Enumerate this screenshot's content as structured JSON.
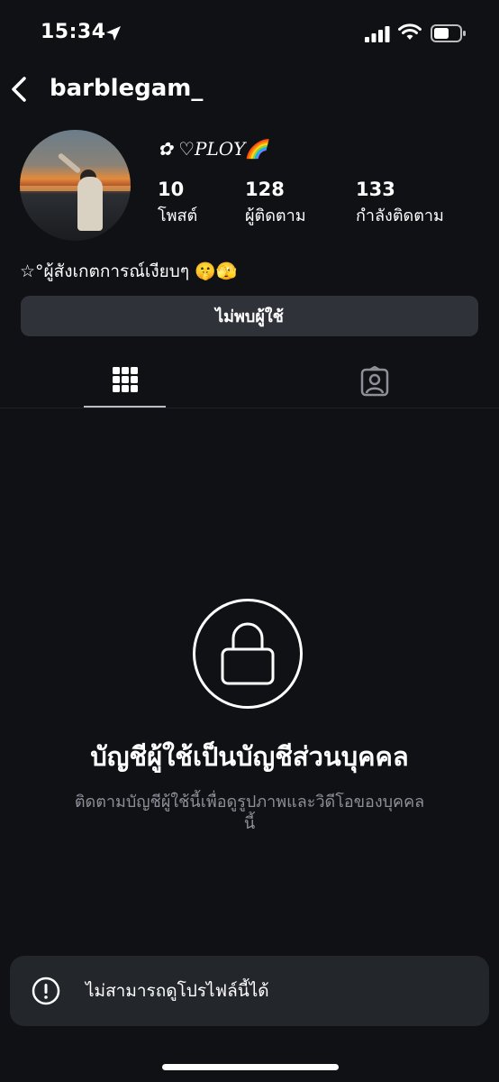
{
  "status_bar": {
    "time": "15:34",
    "icons": [
      "location-arrow-icon",
      "cellular-signal-icon",
      "wifi-icon",
      "battery-icon"
    ]
  },
  "header": {
    "username": "barblegam_"
  },
  "profile": {
    "display_name": "✿ ♡PLOY🌈",
    "stats": [
      {
        "value": "10",
        "label": "โพสต์"
      },
      {
        "value": "128",
        "label": "ผู้ติดตาม"
      },
      {
        "value": "133",
        "label": "กำลังติดตาม"
      }
    ],
    "bio": "☆°ผู้สังเกตการณ์เงียบๆ 🤫🫣",
    "status_button": "ไม่พบผู้ใช้"
  },
  "tabs": [
    {
      "icon": "grid-icon",
      "selected": true
    },
    {
      "icon": "tagged-person-icon",
      "selected": false
    }
  ],
  "private_notice": {
    "icon": "lock-icon",
    "title": "บัญชีผู้ใช้เป็นบัญชีส่วนบุคคล",
    "description": "ติดตามบัญชีผู้ใช้นี้เพื่อดูรูปภาพและวิดีโอของบุคคลนี้"
  },
  "toast": {
    "icon": "alert-circle-icon",
    "message": "ไม่สามารถดูโปรไฟล์นี้ได้"
  },
  "colors": {
    "background": "#0f1115",
    "button_bg": "#2f3238",
    "toast_bg": "#23262b",
    "muted_text": "#8d9098"
  }
}
